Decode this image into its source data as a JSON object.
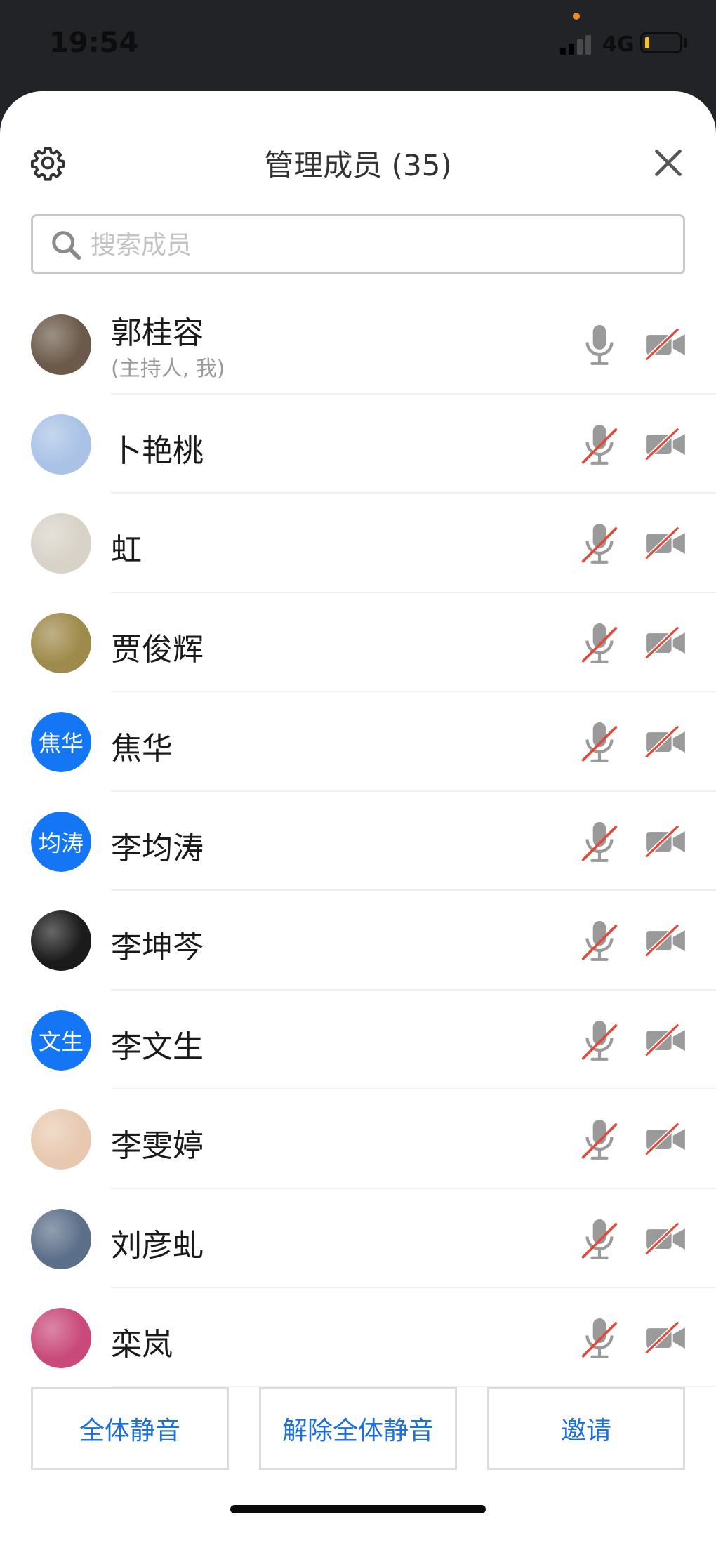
{
  "status_bar": {
    "time": "19:54",
    "network": "4G"
  },
  "header": {
    "title": "管理成员 (35)",
    "settings_icon": "gear-icon",
    "close_icon": "close-icon"
  },
  "search": {
    "placeholder": "搜索成员",
    "value": ""
  },
  "members": [
    {
      "name": "郭桂容",
      "sub": "(主持人, 我)",
      "avatar_type": "photo",
      "avatar_color": "#6b5a4a",
      "mic_muted": false,
      "camera_off": true
    },
    {
      "name": "卜艳桃",
      "sub": "",
      "avatar_type": "photo",
      "avatar_color": "#a9c2e6",
      "mic_muted": true,
      "camera_off": true
    },
    {
      "name": "虹",
      "sub": "",
      "avatar_type": "photo",
      "avatar_color": "#d8d2c8",
      "mic_muted": true,
      "camera_off": true
    },
    {
      "name": "贾俊辉",
      "sub": "",
      "avatar_type": "photo",
      "avatar_color": "#9e8a4a",
      "mic_muted": true,
      "camera_off": true
    },
    {
      "name": "焦华",
      "sub": "",
      "avatar_type": "text",
      "avatar_text": "焦华",
      "avatar_color": "#1476f5",
      "mic_muted": true,
      "camera_off": true
    },
    {
      "name": "李均涛",
      "sub": "",
      "avatar_type": "text",
      "avatar_text": "均涛",
      "avatar_color": "#1476f5",
      "mic_muted": true,
      "camera_off": true
    },
    {
      "name": "李坤芩",
      "sub": "",
      "avatar_type": "photo",
      "avatar_color": "#1b1b1b",
      "mic_muted": true,
      "camera_off": true
    },
    {
      "name": "李文生",
      "sub": "",
      "avatar_type": "text",
      "avatar_text": "文生",
      "avatar_color": "#1476f5",
      "mic_muted": true,
      "camera_off": true
    },
    {
      "name": "李雯婷",
      "sub": "",
      "avatar_type": "photo",
      "avatar_color": "#e8c9b0",
      "mic_muted": true,
      "camera_off": true
    },
    {
      "name": "刘彦虬",
      "sub": "",
      "avatar_type": "photo",
      "avatar_color": "#5c6f8a",
      "mic_muted": true,
      "camera_off": true
    },
    {
      "name": "栾岚",
      "sub": "",
      "avatar_type": "photo",
      "avatar_color": "#c94a7a",
      "mic_muted": true,
      "camera_off": true
    }
  ],
  "footer": {
    "mute_all": "全体静音",
    "unmute_all": "解除全体静音",
    "invite": "邀请"
  },
  "colors": {
    "accent": "#1b6fe0",
    "avatar_blue": "#1476f5",
    "muted_slash": "#e04a3a",
    "icon_gray": "#9a9a9a"
  }
}
